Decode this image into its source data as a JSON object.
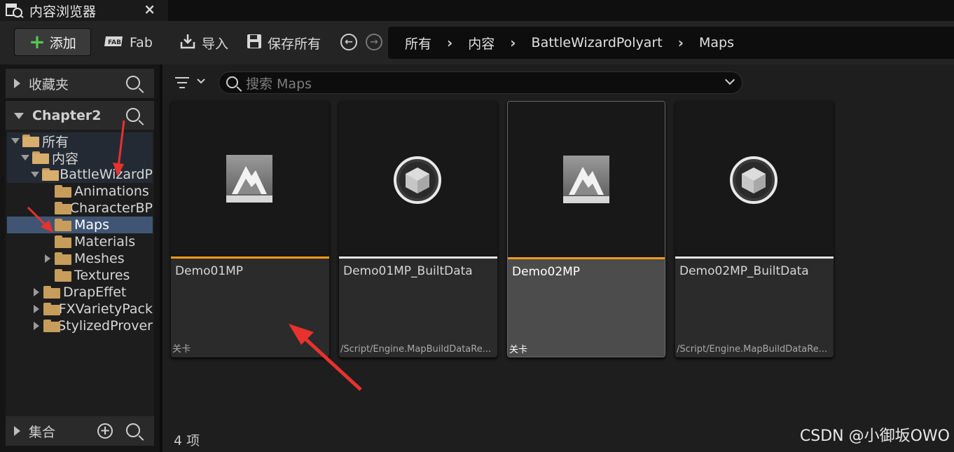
{
  "tab": {
    "title": "内容浏览器",
    "close": "×"
  },
  "toolbar": {
    "add_label": "添加",
    "fab_label": "Fab",
    "import_label": "导入",
    "save_all_label": "保存所有",
    "back": "←",
    "forward": "→"
  },
  "breadcrumb": [
    "所有",
    "内容",
    "BattleWizardPolyart",
    "Maps"
  ],
  "left": {
    "favorites_label": "收藏夹",
    "project_label": "Chapter2",
    "collections_label": "集合",
    "tree": [
      {
        "label": "所有"
      },
      {
        "label": "内容"
      },
      {
        "label": "BattleWizardP"
      },
      {
        "label": "Animations"
      },
      {
        "label": "CharacterBP"
      },
      {
        "label": "Maps"
      },
      {
        "label": "Materials"
      },
      {
        "label": "Meshes"
      },
      {
        "label": "Textures"
      },
      {
        "label": "DrapEffet"
      },
      {
        "label": "FXVarietyPack"
      },
      {
        "label": "StylizedProver"
      }
    ]
  },
  "main": {
    "search_placeholder": "搜索 Maps",
    "item_count": "4 项",
    "assets": [
      {
        "name": "Demo01MP",
        "type": "关卡",
        "bar_color": "#f39a1a"
      },
      {
        "name": "Demo01MP_BuiltData",
        "type": "/Script/Engine.MapBuildDataRe...",
        "bar_color": "#e6e6e6"
      },
      {
        "name": "Demo02MP",
        "type": "关卡",
        "bar_color": "#f39a1a"
      },
      {
        "name": "Demo02MP_BuiltData",
        "type": "/Script/Engine.MapBuildDataRe...",
        "bar_color": "#e6e6e6"
      }
    ]
  },
  "watermark": "CSDN @小御坂OWO",
  "colors": {
    "accent_orange": "#f39a1a",
    "selection": "#3f5573",
    "folder": "#c79d5c",
    "arrow": "#e8322e"
  }
}
